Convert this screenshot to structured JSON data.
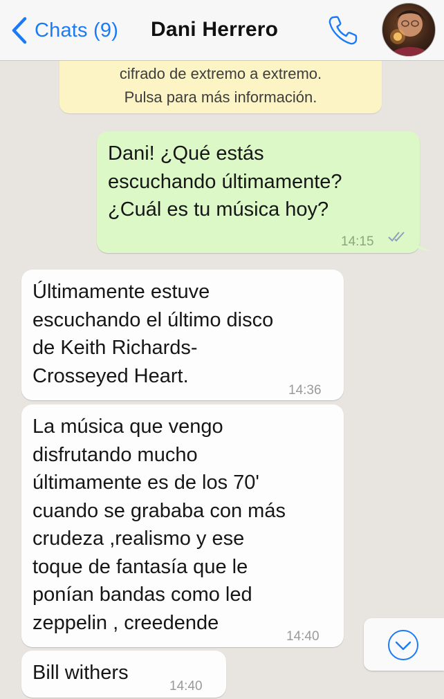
{
  "header": {
    "back_label": "Chats (9)",
    "title": "Dani Herrero"
  },
  "icons": {
    "back": "chevron-left-icon",
    "call": "phone-icon",
    "scroll_down": "chevron-down-circle-icon",
    "read": "double-check-icon"
  },
  "colors": {
    "accent": "#1b7bf6",
    "outgoing_bubble": "#dcf8c6",
    "incoming_bubble": "#fdfdfd",
    "system_note": "#fcf4c4"
  },
  "system_note": {
    "line1": "cifrado de extremo a extremo.",
    "line2": "Pulsa para más información."
  },
  "messages": [
    {
      "direction": "out",
      "text": "Dani! ¿Qué estás\nescuchando últimamente?\n¿Cuál es tu música hoy?",
      "time": "14:15",
      "status": "read"
    },
    {
      "direction": "in",
      "text": "Últimamente estuve\nescuchando el último disco\nde Keith Richards-\nCrosseyed Heart.",
      "time": "14:36"
    },
    {
      "direction": "in",
      "text": "La música que vengo\ndisfrutando mucho\núltimamente es de los 70'\ncuando se grababa con más\ncrudeza ,realismo y ese\ntoque de fantasía que le\nponían bandas como led\nzeppelin , creedende",
      "time": "14:40"
    },
    {
      "direction": "in",
      "text": "Bill withers",
      "time": "14:40"
    }
  ]
}
